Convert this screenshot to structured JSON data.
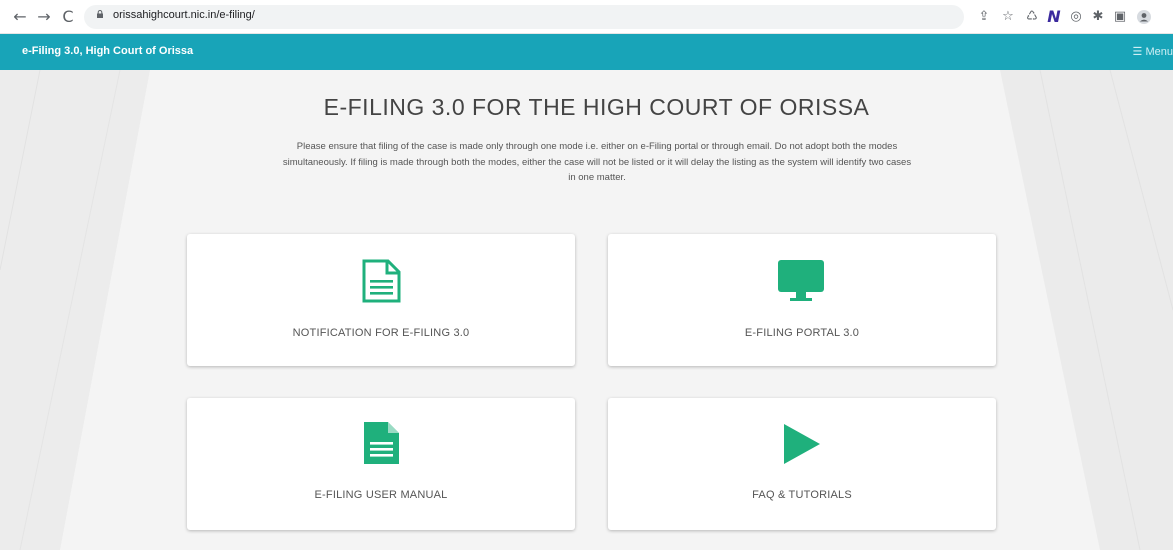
{
  "browser": {
    "url": "orissahighcourt.nic.in/e-filing/",
    "extension_letter": "N"
  },
  "navbar": {
    "brand": "e-Filing 3.0, High Court of Orissa",
    "menu_label": "Menu"
  },
  "main": {
    "title": "E-FILING 3.0 FOR THE HIGH COURT OF ORISSA",
    "notice": "Please ensure that filing of the case is made only through one mode i.e. either on e-Filing portal or through email. Do not adopt both the modes simultaneously. If filing is made through both the modes, either the case will not be listed or it will delay the listing as the system will identify two cases in one matter.",
    "cards": [
      {
        "label": "NOTIFICATION FOR E-FILING 3.0",
        "icon": "document-outline-icon"
      },
      {
        "label": "E-FILING PORTAL 3.0",
        "icon": "desktop-icon"
      },
      {
        "label": "E-FILING USER MANUAL",
        "icon": "document-icon"
      },
      {
        "label": "FAQ & TUTORIALS",
        "icon": "play-icon"
      }
    ]
  },
  "colors": {
    "navbar": "#18a4b8",
    "icon_green": "#1fb07c"
  }
}
